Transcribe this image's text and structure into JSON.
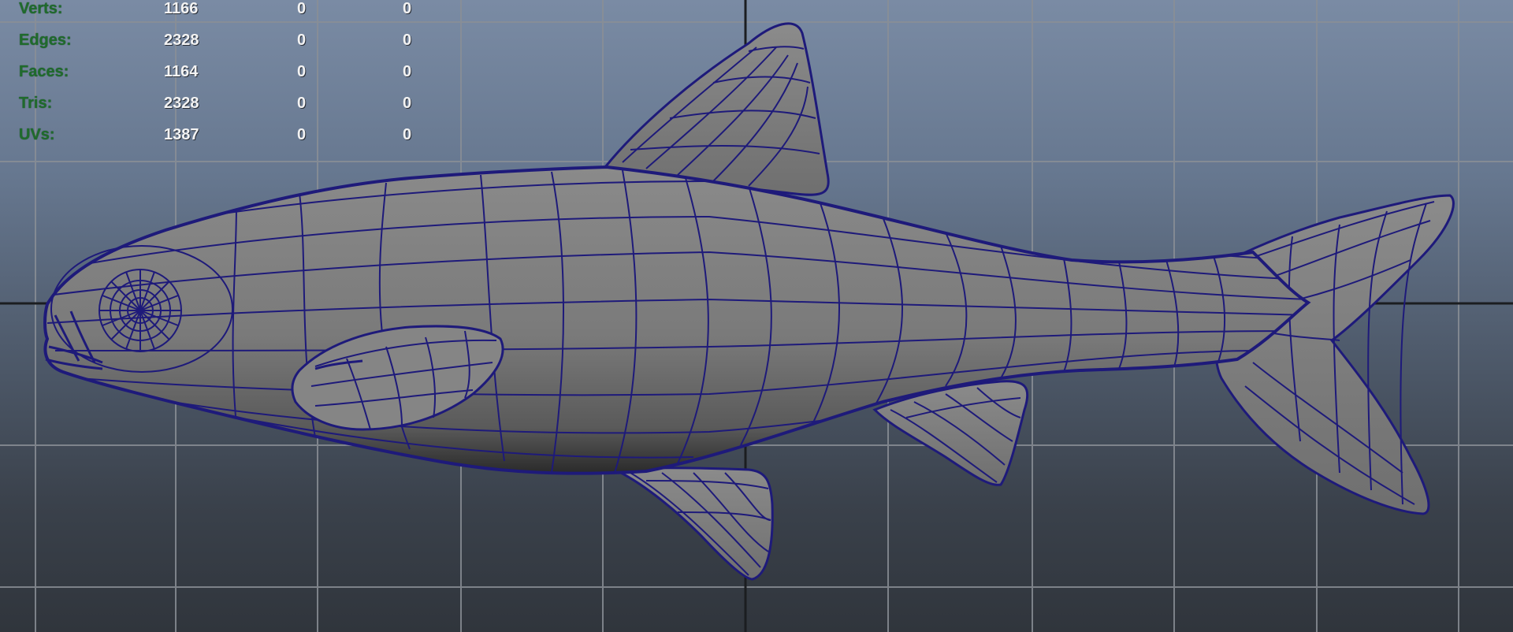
{
  "viewport": {
    "name": "perspective-viewport",
    "background_top": "#7a8ba4",
    "background_bottom": "#30353c",
    "grid_color": "#8a8f96",
    "axis_color": "#1b1d20",
    "wireframe_color": "#1e1a7a",
    "shaded_color": "#7d7d7d"
  },
  "hud": {
    "rows": [
      {
        "label": "Verts:",
        "values": [
          "1166",
          "0",
          "0"
        ]
      },
      {
        "label": "Edges:",
        "values": [
          "2328",
          "0",
          "0"
        ]
      },
      {
        "label": "Faces:",
        "values": [
          "1164",
          "0",
          "0"
        ]
      },
      {
        "label": "Tris:",
        "values": [
          "2328",
          "0",
          "0"
        ]
      },
      {
        "label": "UVs:",
        "values": [
          "1387",
          "0",
          "0"
        ]
      }
    ]
  },
  "model": {
    "name": "fish-mesh"
  }
}
